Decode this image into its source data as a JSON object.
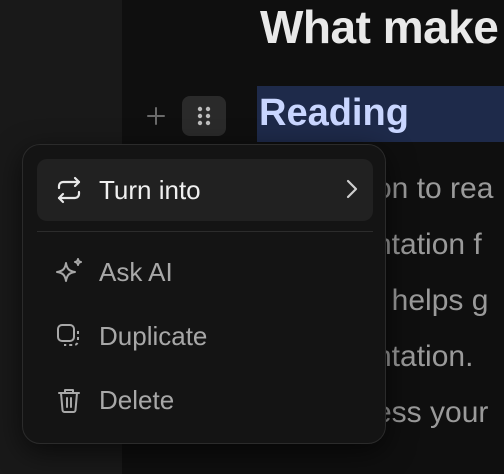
{
  "page": {
    "title": "What make",
    "heading": "Reading",
    "paragraph_lines": [
      "on to rea",
      "ntation f",
      "t helps g",
      "ntation.",
      "ess your"
    ]
  },
  "block_controls": {
    "add_icon": "plus-icon",
    "drag_icon": "drag-handle-icon"
  },
  "menu": {
    "items": [
      {
        "label": "Turn into",
        "icon": "turn-into-icon",
        "has_submenu": true
      },
      {
        "label": "Ask AI",
        "icon": "sparkle-icon"
      },
      {
        "label": "Duplicate",
        "icon": "duplicate-icon"
      },
      {
        "label": "Delete",
        "icon": "trash-icon"
      }
    ]
  },
  "colors": {
    "background": "#0f0f0f",
    "selection": "#1e2a4a",
    "menu_bg": "#141414",
    "active_item": "#212121"
  }
}
